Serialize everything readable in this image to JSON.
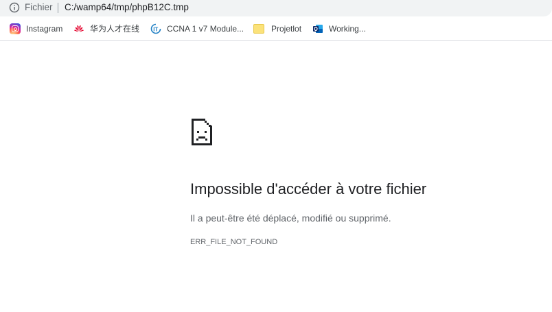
{
  "address_bar": {
    "scheme_label": "Fichier",
    "url": "C:/wamp64/tmp/phpB12C.tmp"
  },
  "bookmarks": [
    {
      "label": "Instagram",
      "icon": "instagram-icon"
    },
    {
      "label": "华为人才在线",
      "icon": "huawei-icon"
    },
    {
      "label": "CCNA 1 v7 Module...",
      "icon": "ccna-icon"
    },
    {
      "label": "Projetlot",
      "icon": "folder-icon"
    },
    {
      "label": "Working...",
      "icon": "outlook-icon"
    }
  ],
  "error": {
    "icon": "sad-file-icon",
    "title": "Impossible d'accéder à votre fichier",
    "description": "Il a peut-être été déplacé, modifié ou supprimé.",
    "code": "ERR_FILE_NOT_FOUND"
  },
  "colors": {
    "address_bg": "#f1f3f4",
    "title": "#202124",
    "secondary_text": "#5f6368"
  }
}
